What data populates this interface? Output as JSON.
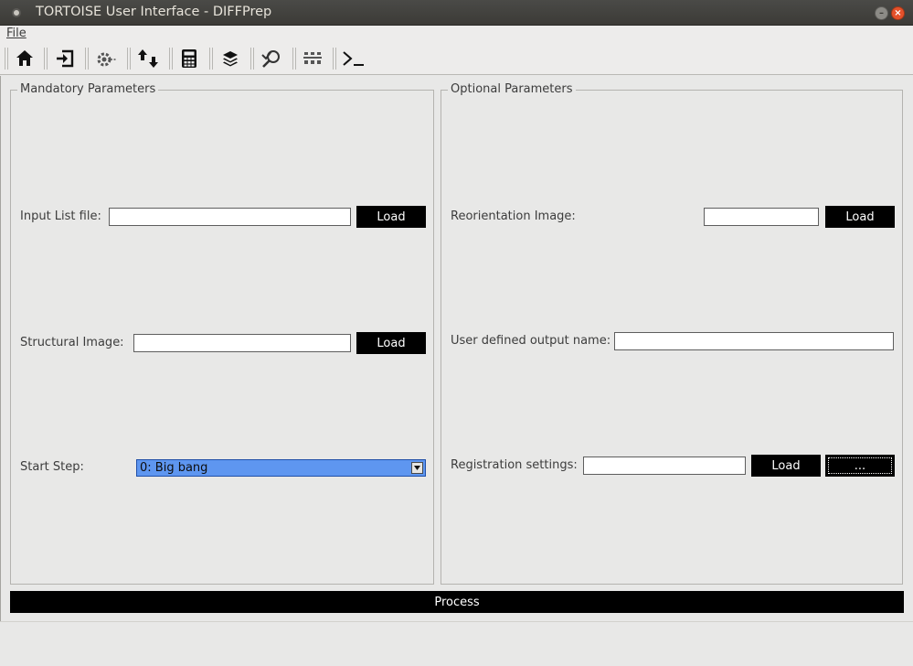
{
  "window": {
    "title": "TORTOISE User Interface - DIFFPrep",
    "minimize_glyph": "–",
    "close_glyph": "×"
  },
  "menu": {
    "file_label": "File"
  },
  "toolbar": {
    "buttons": [
      {
        "name": "home-icon"
      },
      {
        "name": "import-icon"
      },
      {
        "name": "settings-gear-icon"
      },
      {
        "name": "sort-arrows-icon"
      },
      {
        "name": "calculator-icon"
      },
      {
        "name": "layers-icon"
      },
      {
        "name": "check-search-icon"
      },
      {
        "name": "cluster-icon"
      },
      {
        "name": "terminal-icon"
      }
    ]
  },
  "mandatory": {
    "title": "Mandatory Parameters",
    "input_list_label": "Input List file:",
    "input_list_value": "",
    "input_list_load": "Load",
    "structural_label": "Structural Image:",
    "structural_value": "",
    "structural_load": "Load",
    "start_step_label": "Start Step:",
    "start_step_value": "0: Big bang"
  },
  "optional": {
    "title": "Optional Parameters",
    "reorientation_label": "Reorientation Image:",
    "reorientation_value": "",
    "reorientation_load": "Load",
    "output_name_label": "User defined output name:",
    "output_name_value": "",
    "registration_label": "Registration settings:",
    "registration_value": "",
    "registration_load": "Load",
    "registration_more": "..."
  },
  "process_label": "Process"
}
